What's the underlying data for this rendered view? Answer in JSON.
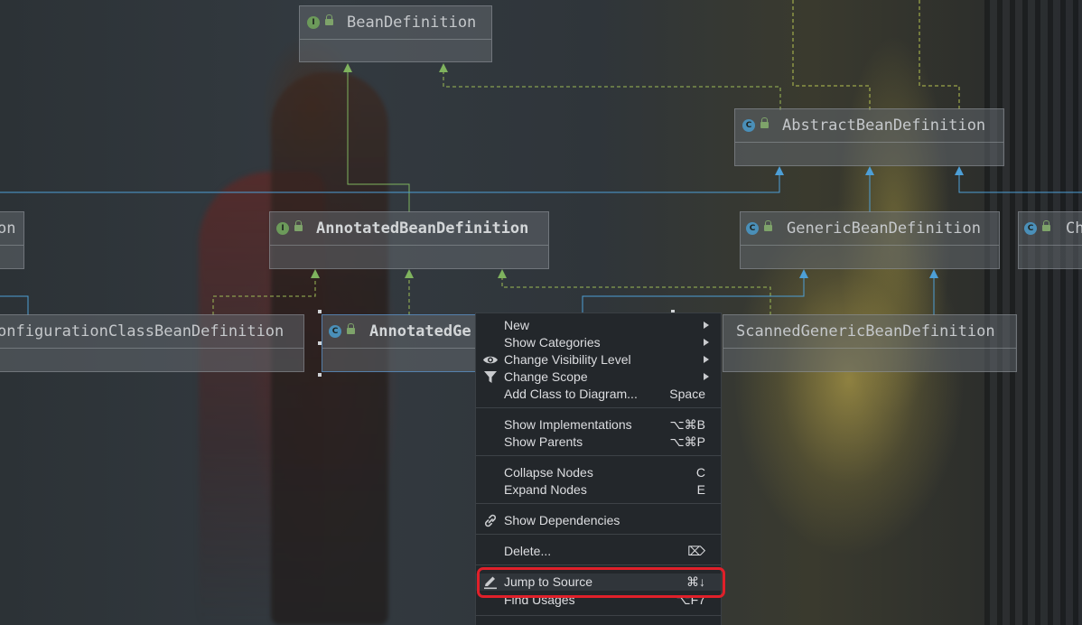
{
  "diagram": {
    "nodes": [
      {
        "id": "bean-definition",
        "title": "BeanDefinition",
        "badge": "I"
      },
      {
        "id": "abstract-bean-definition",
        "title": "AbstractBeanDefinition",
        "badge": "C"
      },
      {
        "id": "annotated-bean-definition",
        "title": "AnnotatedBeanDefinition",
        "badge": "I"
      },
      {
        "id": "generic-bean-definition",
        "title": "GenericBeanDefinition",
        "badge": "C"
      },
      {
        "id": "left-partial-1",
        "title": "on",
        "badge": ""
      },
      {
        "id": "right-partial",
        "title": "Ch",
        "badge": "C"
      },
      {
        "id": "configuration-class-bean-definition",
        "title": "onfigurationClassBeanDefinition",
        "badge": ""
      },
      {
        "id": "annotated-generic",
        "title": "AnnotatedGe",
        "badge": "C"
      },
      {
        "id": "scanned-generic-bean-definition",
        "title": "ScannedGenericBeanDefinition",
        "badge": ""
      }
    ],
    "colors": {
      "implements": "#7fb35e",
      "extends": "#4d9fd6",
      "interface_badge": "#6c9a5a",
      "class_badge": "#4a8fb8"
    }
  },
  "context_menu": {
    "new": {
      "label": "New"
    },
    "show_categories": {
      "label": "Show Categories"
    },
    "change_visibility": {
      "label": "Change Visibility Level",
      "icon": "eye-icon"
    },
    "change_scope": {
      "label": "Change Scope",
      "icon": "filter-icon"
    },
    "add_class": {
      "label": "Add Class to Diagram...",
      "shortcut": "Space"
    },
    "show_implementations": {
      "label": "Show Implementations",
      "shortcut": "⌥⌘B"
    },
    "show_parents": {
      "label": "Show Parents",
      "shortcut": "⌥⌘P"
    },
    "collapse_nodes": {
      "label": "Collapse Nodes",
      "shortcut": "C"
    },
    "expand_nodes": {
      "label": "Expand Nodes",
      "shortcut": "E"
    },
    "show_dependencies": {
      "label": "Show Dependencies",
      "icon": "link-icon"
    },
    "delete": {
      "label": "Delete...",
      "shortcut": "⌦"
    },
    "jump_to_source": {
      "label": "Jump to Source",
      "shortcut": "⌘↓",
      "icon": "pencil-icon"
    },
    "find_usages": {
      "label": "Find Usages",
      "shortcut": "⌥F7"
    },
    "highlight_color": "#e0202a"
  }
}
